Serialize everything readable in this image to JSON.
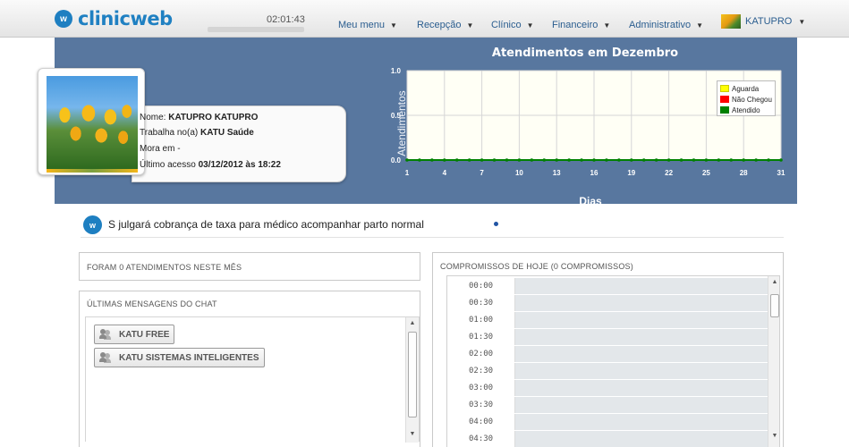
{
  "topbar": {
    "logo_text": "clinicweb",
    "logo_mark": "w",
    "clock": "02:01:43",
    "nav": [
      {
        "label": "Meu menu"
      },
      {
        "label": "Recepção"
      },
      {
        "label": "Clínico"
      },
      {
        "label": "Financeiro"
      },
      {
        "label": "Administrativo"
      }
    ],
    "user": {
      "name": "KATUPRO"
    }
  },
  "profile": {
    "name_label": "Nome:",
    "name_value": "KATUPRO KATUPRO",
    "works_label": "Trabalha no(a)",
    "works_value": "KATU Saúde",
    "lives_label": "Mora em -",
    "last_access_label": "Último acesso",
    "last_access_value": "03/12/2012 às 18:22"
  },
  "chart_data": {
    "type": "line",
    "title": "Atendimentos em Dezembro",
    "xlabel": "Dias",
    "ylabel": "Atendimentos",
    "x": [
      1,
      2,
      3,
      4,
      5,
      6,
      7,
      8,
      9,
      10,
      11,
      12,
      13,
      14,
      15,
      16,
      17,
      18,
      19,
      20,
      21,
      22,
      23,
      24,
      25,
      26,
      27,
      28,
      29,
      30,
      31
    ],
    "x_ticks": [
      1,
      4,
      7,
      10,
      13,
      16,
      19,
      22,
      25,
      28,
      31
    ],
    "y_ticks": [
      "0.0",
      "0.5",
      "1.0"
    ],
    "ylim": [
      0,
      1
    ],
    "grid": true,
    "legend_position": "top-right",
    "series": [
      {
        "name": "Aguarda",
        "color": "#ffff00",
        "values": [
          0,
          0,
          0,
          0,
          0,
          0,
          0,
          0,
          0,
          0,
          0,
          0,
          0,
          0,
          0,
          0,
          0,
          0,
          0,
          0,
          0,
          0,
          0,
          0,
          0,
          0,
          0,
          0,
          0,
          0,
          0
        ]
      },
      {
        "name": "Não Chegou",
        "color": "#ff0000",
        "values": [
          0,
          0,
          0,
          0,
          0,
          0,
          0,
          0,
          0,
          0,
          0,
          0,
          0,
          0,
          0,
          0,
          0,
          0,
          0,
          0,
          0,
          0,
          0,
          0,
          0,
          0,
          0,
          0,
          0,
          0,
          0
        ]
      },
      {
        "name": "Atendido",
        "color": "#008000",
        "values": [
          0,
          0,
          0,
          0,
          0,
          0,
          0,
          0,
          0,
          0,
          0,
          0,
          0,
          0,
          0,
          0,
          0,
          0,
          0,
          0,
          0,
          0,
          0,
          0,
          0,
          0,
          0,
          0,
          0,
          0,
          0
        ]
      }
    ]
  },
  "ticker": {
    "text": "S julgará cobrança de taxa para médico acompanhar parto normal"
  },
  "panels": {
    "atendimentos_title": "FORAM 0 ATENDIMENTOS NESTE MÊS",
    "chat_title": "ÚLTIMAS MENSAGENS DO CHAT",
    "chat_contacts": [
      {
        "label": "KATU FREE"
      },
      {
        "label": "KATU SISTEMAS INTELIGENTES"
      }
    ],
    "compromissos_title": "COMPROMISSOS DE HOJE (0 COMPROMISSOS)",
    "agenda_times": [
      "00:00",
      "00:30",
      "01:00",
      "01:30",
      "02:00",
      "02:30",
      "03:00",
      "03:30",
      "04:00",
      "04:30"
    ]
  },
  "colors": {
    "band": "#58779f",
    "brand": "#1f80c2",
    "nav_link": "#2a5d8f",
    "agenda_slot": "#e3e7ea"
  }
}
